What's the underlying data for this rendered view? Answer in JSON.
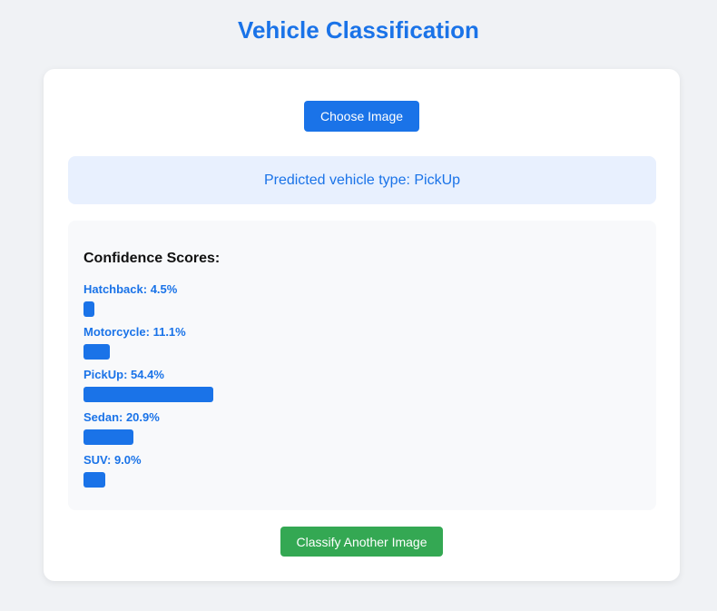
{
  "header": {
    "title": "Vehicle Classification"
  },
  "upload": {
    "choose_label": "Choose Image"
  },
  "prediction": {
    "text": "Predicted vehicle type: PickUp"
  },
  "scores": {
    "heading": "Confidence Scores:",
    "items": [
      {
        "label": "Hatchback: 4.5%",
        "value": 4.5
      },
      {
        "label": "Motorcycle: 11.1%",
        "value": 11.1
      },
      {
        "label": "PickUp: 54.4%",
        "value": 54.4
      },
      {
        "label": "Sedan: 20.9%",
        "value": 20.9
      },
      {
        "label": "SUV: 9.0%",
        "value": 9.0
      }
    ]
  },
  "actions": {
    "classify_another_label": "Classify Another Image"
  },
  "colors": {
    "accent": "#1a73e8",
    "success": "#34a853",
    "prediction_bg": "#e8f0fe",
    "panel_bg": "#f8f9fb",
    "page_bg": "#f0f2f5"
  }
}
